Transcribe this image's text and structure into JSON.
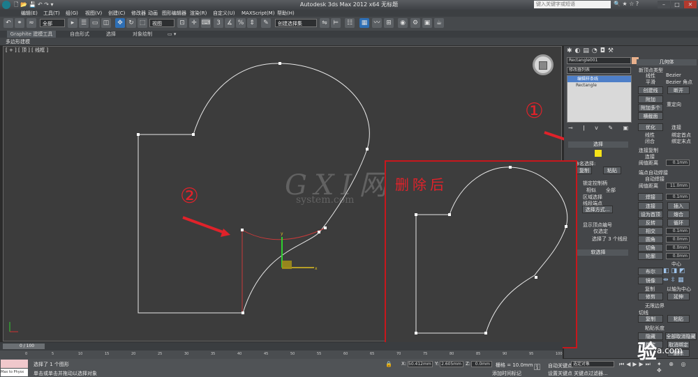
{
  "window": {
    "title": "Autodesk 3ds Max  2012 x64    无标题",
    "search_placeholder": "键入关键字或短语"
  },
  "menu": [
    "编辑(E)",
    "工具(T)",
    "组(G)",
    "视图(V)",
    "创建(C)",
    "修改器",
    "动画",
    "图形编辑器",
    "渲染(R)",
    "自定义(U)",
    "MAXScript(M)",
    "帮助(H)"
  ],
  "toolbar": {
    "selection_filter": "全部",
    "ref_coord": "视图",
    "named_sel": "创建选择集",
    "snap_value": "3",
    "angle_snap": "%"
  },
  "ribbon": {
    "tabs": [
      "Graphite 建模工具",
      "自由形式",
      "选择",
      "对象绘制"
    ],
    "sub": "多边形建模"
  },
  "viewport": {
    "label": "[ + ] [ 顶 ] [ 线框 ]"
  },
  "right_panel": {
    "object_name": "Rectangle001",
    "modifier_list": "修改器列表",
    "stack_item_1": "编辑样条线",
    "stack_item_2": "Rectangle",
    "geometry_header": "几何体",
    "new_vertex_type": "新顶点类型",
    "linear": "线性",
    "bezier": "Bezier",
    "smooth": "平滑",
    "bezier_corner": "Bezier 角点",
    "create_line": "创建线",
    "break": "断开",
    "attach": "附加",
    "attach_multi": "附加多个",
    "reorient": "重定向",
    "cross_section": "横截面",
    "refine": "优化",
    "connect": "连接",
    "linear2": "线性",
    "bind_first": "绑定首点",
    "closed": "闭合",
    "bind_last": "绑定末点",
    "connect_copy": "连接复制",
    "connect_copy_cb": "连接",
    "threshold_label": "阈值距离",
    "threshold_value": "0.1mm",
    "end_weld": "端点自动焊接",
    "auto_weld": "自动焊接",
    "threshold2_label": "阈值距离",
    "threshold2_value": "11.0mm",
    "weld": "焊接",
    "weld_val": "0.1mm",
    "connect2": "连接",
    "insert": "插入",
    "set_first": "设为首顶点",
    "fuse": "熔合",
    "reverse": "反转",
    "cycle": "循环",
    "crossinsert": "相交",
    "cross_val": "0.1mm",
    "fillet": "圆角",
    "fillet_val": "0.0mm",
    "chamfer": "切角",
    "chamfer_val": "0.0mm",
    "outline": "轮廓",
    "outline_val": "0.0mm",
    "center": "中心",
    "boolean": "布尔",
    "mirror": "镜像",
    "copy": "复制",
    "about_pivot": "以轴为中心",
    "trim": "修剪",
    "extend": "延伸",
    "infinite": "无限边界",
    "tangent": "切线",
    "copy2": "复制",
    "paste": "粘贴",
    "paste_len": "粘贴长度",
    "hide": "隐藏",
    "unhide_all": "全部取消隐藏",
    "bind": "绑定",
    "unbind": "取消绑定",
    "delete": "删除",
    "selection_header": "选择",
    "copy_sel": "复制",
    "paste_sel": "粘贴",
    "named_sel": "命名选择:",
    "lock_handles": "锁定控制柄",
    "alike": "相似",
    "all": "全部",
    "area_sel": "区域选择",
    "seg_end": "线段端点",
    "select_by": "选择方式...",
    "show_vertex_num": "显示顶点编号",
    "only_selected": "仅选定",
    "selected_info": "选择了 3 个线段",
    "soft_sel": "软选择"
  },
  "annotations": {
    "circled_1": "①",
    "circled_2": "②",
    "inset_title": "删除后",
    "watermark": "GXI网",
    "watermark_sub": "system.com"
  },
  "timeline": {
    "frame": "0 / 100",
    "ticks": [
      "0",
      "5",
      "10",
      "15",
      "20",
      "25",
      "30",
      "35",
      "40",
      "45",
      "50",
      "55",
      "60",
      "65",
      "70",
      "75",
      "80",
      "85",
      "90",
      "95",
      "100"
    ]
  },
  "status": {
    "max_to_physx": "Max to Physx",
    "sel_count": "选择了 1 个图形",
    "prompt": "单击或单击并拖动以选择对象",
    "x_label": "X:",
    "x_value": "50.412mm",
    "y_label": "Y:",
    "y_value": "2.605mm",
    "z_label": "Z:",
    "z_value": "0.0mm",
    "grid": "栅格 = 10.0mm",
    "auto_key": "自动关键点",
    "set_key": "设置关键点",
    "key_filter": "关键点过滤器...",
    "selected_obj": "选定对象",
    "add_time_tag": "添加时间标记"
  },
  "badge": "验",
  "badge_sub": "a.com"
}
